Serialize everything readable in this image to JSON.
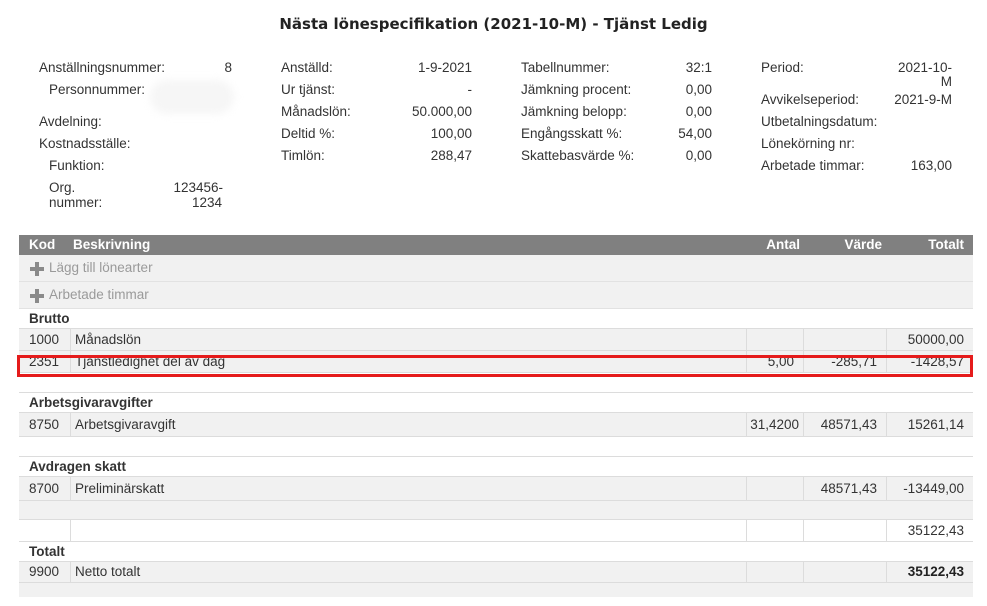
{
  "title": "Nästa lönespecifikation (2021-10-M) - Tjänst Ledig",
  "info": {
    "col1": {
      "anstallningsnummer_label": "Anställningsnummer:",
      "anstallningsnummer_value": "8",
      "personnummer_label": "Personnummer:",
      "avdelning_label": "Avdelning:",
      "kostnadsstalle_label": "Kostnadsställe:",
      "funktion_label": "Funktion:",
      "org_label_1": "Org.",
      "org_label_2": "nummer:",
      "org_value_1": "123456-",
      "org_value_2": "1234"
    },
    "col2": {
      "anstalld_label": "Anställd:",
      "anstalld_value": "1-9-2021",
      "ur_tjanst_label": "Ur tjänst:",
      "ur_tjanst_value": "-",
      "manadslon_label": "Månadslön:",
      "manadslon_value": "50.000,00",
      "deltid_label": "Deltid %:",
      "deltid_value": "100,00",
      "timlon_label": "Timlön:",
      "timlon_value": "288,47"
    },
    "col3": {
      "tabellnummer_label": "Tabellnummer:",
      "tabellnummer_value": "32:1",
      "jamkning_procent_label": "Jämkning procent:",
      "jamkning_procent_value": "0,00",
      "jamkning_belopp_label": "Jämkning belopp:",
      "jamkning_belopp_value": "0,00",
      "engangsskatt_label": "Engångsskatt %:",
      "engangsskatt_value": "54,00",
      "skattebasvarde_label": "Skattebasvärde %:",
      "skattebasvarde_value": "0,00"
    },
    "col4": {
      "period_label": "Period:",
      "period_value_1": "2021-10-",
      "period_value_2": "M",
      "avvikelseperiod_label": "Avvikelseperiod:",
      "avvikelseperiod_value": "2021-9-M",
      "utbetalningsdatum_label": "Utbetalningsdatum:",
      "lonekorning_label": "Lönekörning nr:",
      "arbetade_timmar_label": "Arbetade timmar:",
      "arbetade_timmar_value": "163,00"
    }
  },
  "table": {
    "headers": {
      "kod": "Kod",
      "beskrivning": "Beskrivning",
      "antal": "Antal",
      "varde": "Värde",
      "totalt": "Totalt"
    },
    "add_lonearter": "Lägg till lönearter",
    "add_arbetade_timmar": "Arbetade timmar",
    "sections": {
      "brutto": "Brutto",
      "arbetsgivaravgifter": "Arbetsgivaravgifter",
      "avdragen_skatt": "Avdragen skatt",
      "totalt": "Totalt"
    },
    "rows": {
      "manadslon": {
        "kod": "1000",
        "beskrivning": "Månadslön",
        "antal": "",
        "varde": "",
        "totalt": "50000,00"
      },
      "tjanstledighet": {
        "kod": "2351",
        "beskrivning": "Tjänstledighet del av dag",
        "antal": "5,00",
        "varde": "-285,71",
        "totalt": "-1428,57"
      },
      "arbetsgivaravgift": {
        "kod": "8750",
        "beskrivning": "Arbetsgivaravgift",
        "antal": "31,4200",
        "varde": "48571,43",
        "totalt": "15261,14"
      },
      "preliminarskatt": {
        "kod": "8700",
        "beskrivning": "Preliminärskatt",
        "antal": "",
        "varde": "48571,43",
        "totalt": "-13449,00"
      },
      "subtotal": {
        "totalt": "35122,43"
      },
      "netto": {
        "kod": "9900",
        "beskrivning": "Netto totalt",
        "totalt": "35122,43"
      }
    }
  },
  "colors": {
    "header_bg": "#808080",
    "row_bg": "#f1f1f1",
    "highlight": "#e51b1b"
  }
}
